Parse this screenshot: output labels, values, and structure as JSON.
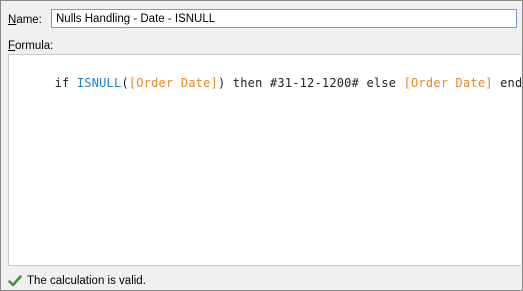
{
  "name_field": {
    "label_ul": "N",
    "label_rest": "ame:",
    "value": "Nulls Handling - Date - ISNULL"
  },
  "formula": {
    "label_ul": "F",
    "label_rest": "ormula:",
    "tokens": [
      {
        "text": "if ",
        "kind": "kw"
      },
      {
        "text": "ISNULL",
        "kind": "fn"
      },
      {
        "text": "(",
        "kind": "lit"
      },
      {
        "text": "[Order Date]",
        "kind": "field"
      },
      {
        "text": ") then #31-12-1200# else ",
        "kind": "lit"
      },
      {
        "text": "[Order Date]",
        "kind": "field"
      },
      {
        "text": " end",
        "kind": "kw"
      }
    ]
  },
  "status": {
    "icon": "check-icon",
    "text": "The calculation is valid.",
    "color": "#3a9a3a"
  },
  "colors": {
    "function": "#1f7fbf",
    "field": "#e8862b",
    "input_border": "#7a9cd3"
  }
}
